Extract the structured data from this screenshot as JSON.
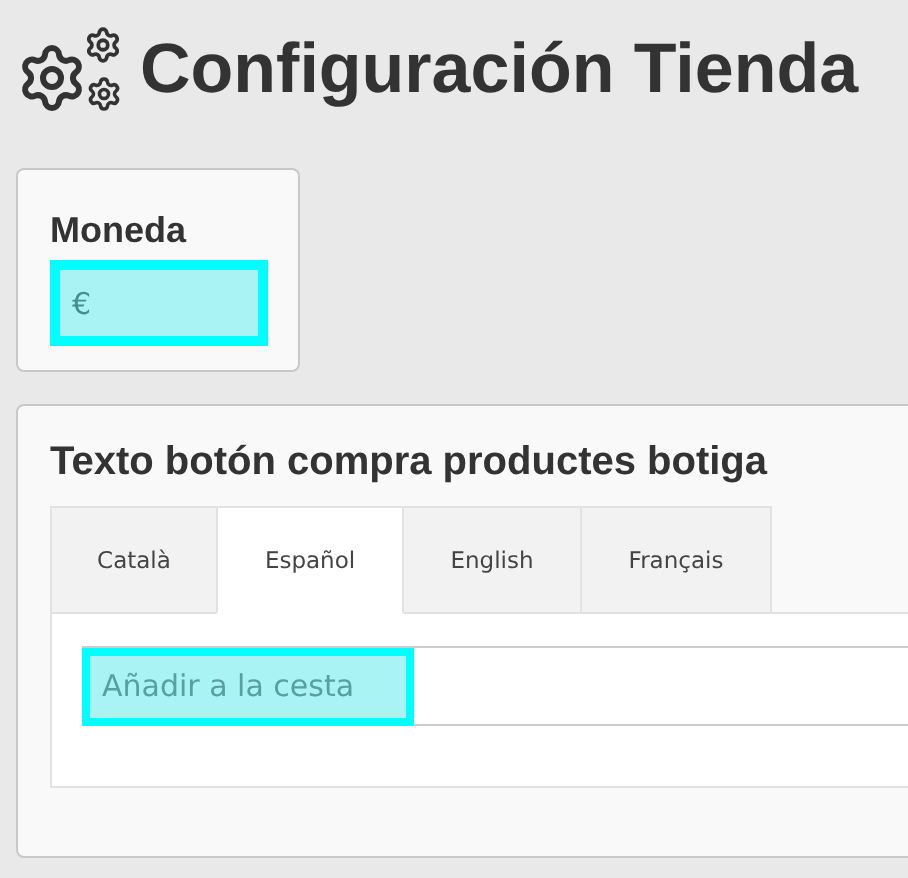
{
  "page": {
    "title": "Configuración Tienda"
  },
  "currency": {
    "label": "Moneda",
    "value": "€"
  },
  "buy_button_text": {
    "title": "Texto botón compra productes botiga",
    "tabs": [
      {
        "label": "Català",
        "selected": false
      },
      {
        "label": "Español",
        "selected": true
      },
      {
        "label": "English",
        "selected": false
      },
      {
        "label": "Français",
        "selected": false
      }
    ],
    "value": "Añadir a la cesta"
  }
}
